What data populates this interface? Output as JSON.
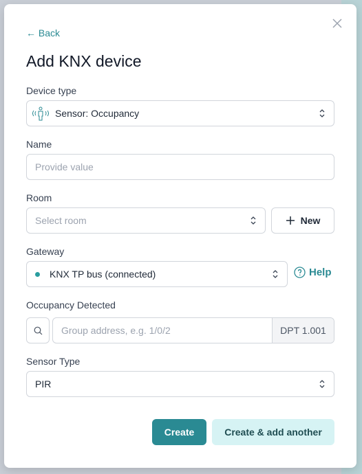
{
  "modal": {
    "back_label": "Back",
    "title": "Add KNX device",
    "device_type": {
      "label": "Device type",
      "value": "Sensor: Occupancy",
      "icon": "occupancy-sensor-icon"
    },
    "name": {
      "label": "Name",
      "placeholder": "Provide value"
    },
    "room": {
      "label": "Room",
      "placeholder": "Select room",
      "new_label": "New"
    },
    "gateway": {
      "label": "Gateway",
      "value": "KNX TP bus (connected)",
      "status_color": "#2a9d9f",
      "help_label": "Help"
    },
    "occupancy": {
      "label": "Occupancy Detected",
      "placeholder": "Group address, e.g. 1/0/2",
      "dpt": "DPT 1.001"
    },
    "sensor_type": {
      "label": "Sensor Type",
      "value": "PIR"
    },
    "create_label": "Create",
    "create_another_label": "Create & add another"
  },
  "colors": {
    "accent": "#2a8a93",
    "accent_light": "#d6f3f4"
  }
}
